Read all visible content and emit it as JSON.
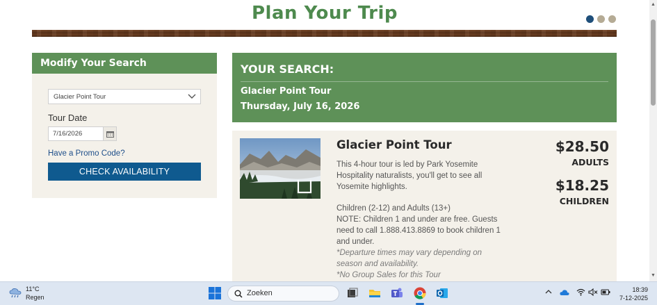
{
  "header": {
    "title": "Plan Your Trip",
    "carousel_dots": 3,
    "active_dot": 1
  },
  "modify": {
    "heading": "Modify Your Search",
    "tour_value": "Glacier Point Tour",
    "date_label": "Tour Date",
    "date_value": "7/16/2026",
    "promo_link": "Have a Promo Code?",
    "check_button": "CHECK AVAILABILITY"
  },
  "summary": {
    "heading": "YOUR SEARCH:",
    "tour": "Glacier Point Tour",
    "date": "Thursday, July 16, 2026"
  },
  "result": {
    "title": "Glacier Point Tour",
    "description": "This 4-hour tour is led by Park Yosemite Hospitality naturalists, you'll get to see all Yosemite highlights.",
    "ages": "Children (2-12) and Adults (13+)",
    "note": "NOTE: Children 1 and under are free. Guests need to call 1.888.413.8869 to book children 1 and under.",
    "departure_note": "*Departure times may vary depending on season and availability.",
    "group_note": "*No Group Sales for this Tour",
    "adult_price": "$28.50",
    "adult_label": "ADULTS",
    "child_price": "$18.25",
    "child_label": "CHILDREN"
  },
  "taskbar": {
    "temperature": "11°C",
    "weather": "Regen",
    "search_placeholder": "Zoeken",
    "time": "18:39",
    "date": "7-12-2025"
  },
  "colors": {
    "brand_green": "#5e9158",
    "title_green": "#4e8a4e",
    "button_blue": "#0f5a8f",
    "panel_bg": "#f4f1ea"
  }
}
